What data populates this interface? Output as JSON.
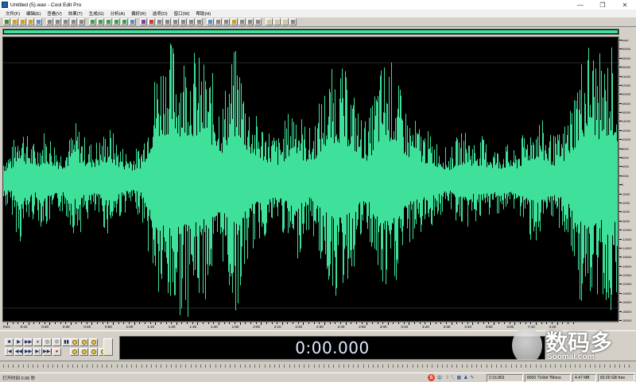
{
  "window": {
    "title": "Untitled (5).wav - Cool Edit Pro",
    "minimize": "—",
    "maximize": "❐",
    "close": "✕"
  },
  "menu": [
    "文件(F)",
    "编辑(E)",
    "查看(V)",
    "效果(T)",
    "生成(G)",
    "分析(A)",
    "偏好(R)",
    "选项(O)",
    "窗口(W)",
    "帮助(H)"
  ],
  "toolbar": {
    "buttons": [
      "#3c8c3c",
      "#c9a227",
      "#c9a227",
      "#c9a227",
      "#5a8fc9",
      "#888888",
      "#888888",
      "#888888",
      "#888888",
      "#888888",
      "#3ca05a",
      "#3ca05a",
      "#3ca05a",
      "#3ca05a",
      "#3ca05a",
      "#5a8fc9",
      "#8a3ca0",
      "#c83c3c",
      "#888888",
      "#888888",
      "#888888",
      "#888888",
      "#888888",
      "#888888",
      "#5a8fc9",
      "#888888",
      "#888888",
      "#c9a227",
      "#888888",
      "#888888",
      "#888888",
      "#c9c9a0",
      "#c9c9a0",
      "#c9c9a0",
      "#888888"
    ]
  },
  "waveform": {
    "color": "#3ee09a",
    "background": "#000000",
    "envelope": [
      0.18,
      0.22,
      0.45,
      0.3,
      0.25,
      0.35,
      0.3,
      0.22,
      0.28,
      0.4,
      0.3,
      0.26,
      0.3,
      0.38,
      0.28,
      0.22,
      0.2,
      0.25,
      0.55,
      0.85,
      0.95,
      0.98,
      0.9,
      0.95,
      0.85,
      0.8,
      0.7,
      0.55,
      0.85,
      0.9,
      0.6,
      0.45,
      0.4,
      0.35,
      0.3,
      0.45,
      0.6,
      0.4,
      0.35,
      0.55,
      0.7,
      0.8,
      0.75,
      0.65,
      0.45,
      0.4,
      0.7,
      0.85,
      0.8,
      0.6,
      0.45,
      0.4,
      0.35,
      0.3,
      0.25,
      0.2,
      0.3,
      0.35,
      0.28,
      0.3,
      0.25,
      0.22,
      0.25,
      0.2,
      0.3,
      0.4,
      0.45,
      0.35,
      0.3,
      0.35,
      0.55,
      0.8,
      0.98,
      0.9,
      0.8,
      0.95,
      0.7
    ]
  },
  "amplitude_scale": [
    "smpl",
    "30000",
    "28000",
    "26000",
    "24000",
    "22000",
    "20000",
    "18000",
    "16000",
    "14000",
    "12000",
    "10000",
    "8000",
    "6000",
    "4000",
    "2000",
    "0",
    "-2000",
    "-4000",
    "-6000",
    "-8000",
    "-10000",
    "-12000",
    "-14000",
    "-16000",
    "-18000",
    "-20000",
    "-22000",
    "-24000",
    "-26000",
    "-28000",
    "-30000"
  ],
  "time_ruler": {
    "unit": "hms",
    "labels": [
      "0:10",
      "0:20",
      "0:30",
      "0:40",
      "0:50",
      "1:00",
      "1:10",
      "1:20",
      "1:30",
      "1:40",
      "1:50",
      "2:00",
      "2:10",
      "2:20",
      "2:30",
      "2:40",
      "2:50",
      "3:00",
      "3:10",
      "3:20",
      "3:30",
      "3:40",
      "3:50",
      "4:00",
      "4:10",
      "4:20"
    ]
  },
  "transport": {
    "row1": [
      "■",
      "▶",
      "▶▶",
      "⏸",
      "◎",
      "⊙",
      "▮▮"
    ],
    "row2": [
      "|◀",
      "◀◀",
      "▶▶",
      "▶|",
      "▶▶|",
      "●"
    ]
  },
  "time_display": "0:00.000",
  "watermark": {
    "chinese": "数码多",
    "url": "Soomal.com"
  },
  "status": {
    "left": "打开时间 0.06 秒",
    "sample_rate": "8000 ?16bit ?Mono",
    "file_size": "4.47 MB",
    "free_space": "83.00 GB free",
    "position": "2:16.853",
    "ime_label": "中"
  }
}
